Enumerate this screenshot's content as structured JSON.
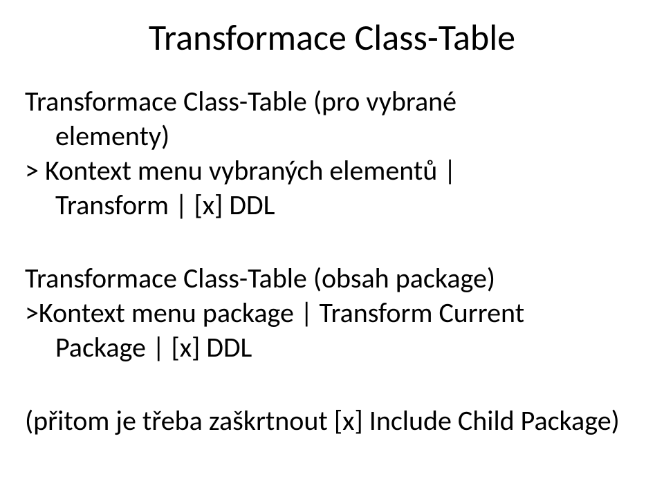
{
  "title": "Transformace Class-Table",
  "block1": {
    "line1": "Transformace Class-Table (pro vybrané",
    "line2": "elementy)",
    "line3": "> Kontext menu vybraných elementů |",
    "line4": "Transform | [x] DDL"
  },
  "block2": {
    "line1": "Transformace Class-Table (obsah package)",
    "line2": ">Kontext menu package | Transform Current",
    "line3": "Package | [x] DDL"
  },
  "note": "(přitom je třeba zaškrtnout [x] Include Child Package)"
}
